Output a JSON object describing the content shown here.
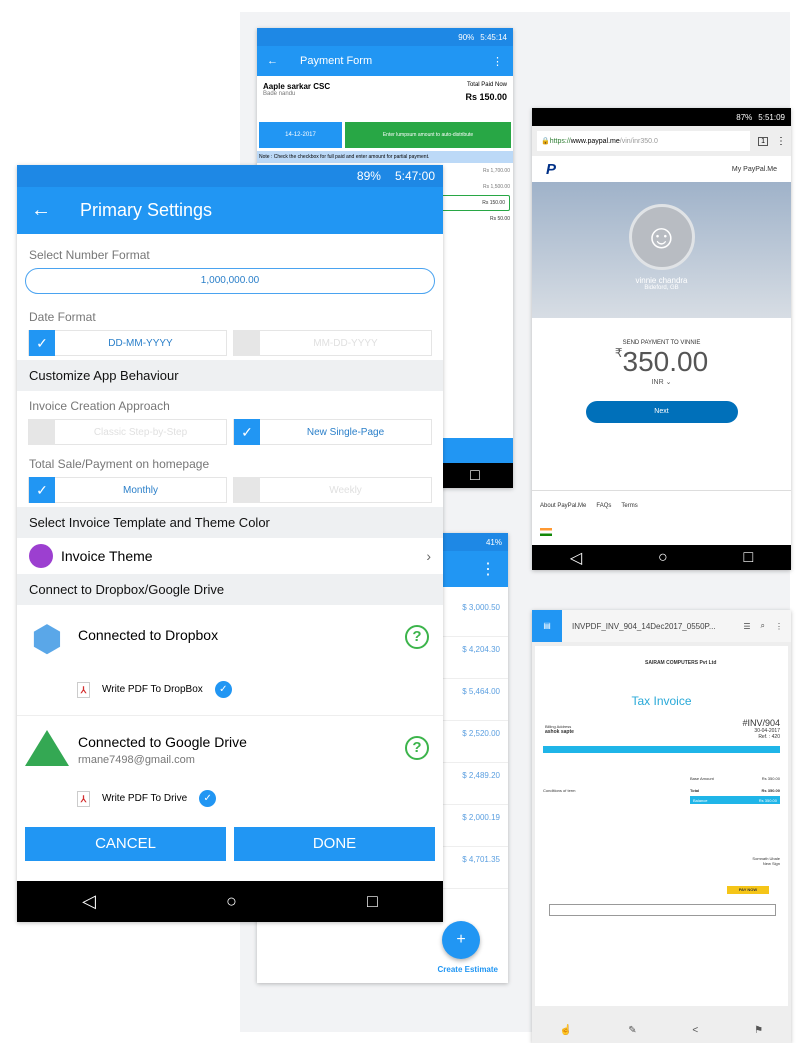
{
  "colors": {
    "primary": "#2196f3",
    "green": "#28a745",
    "paypal_blue": "#0070ba"
  },
  "payment_form": {
    "status": {
      "battery": "90%",
      "time": "5:45:14"
    },
    "title": "Payment Form",
    "party": "Aaple sarkar CSC",
    "sub": "Bade nandu",
    "total_label": "Total Paid Now",
    "total": "Rs 150.00",
    "date": "14-12-2017",
    "lumpsum": "Enter lumpsum amount to auto-distribute",
    "note": "Note : Check the checkbox for full paid and enter amount for partial payment.",
    "amounts": [
      "Rs 1,700.00",
      "Rs 1,500.00",
      "Rs 150.00",
      "Rs 50.00"
    ]
  },
  "paypal": {
    "status": {
      "battery": "87%",
      "time": "5:51:09"
    },
    "url_scheme": "https://",
    "url_host": "www.paypal.me",
    "url_path": "/vin/inr350.0",
    "tabs_count": "1",
    "my_link": "My PayPal.Me",
    "name": "vinnie chandra",
    "location": "Bideford, GB",
    "send_label": "SEND PAYMENT TO VINNIE",
    "currency_symbol": "₹",
    "amount": "350.00",
    "currency": "INR",
    "next": "Next",
    "footer": [
      "About PayPal.Me",
      "FAQs",
      "Terms"
    ]
  },
  "estimates": {
    "status": {
      "battery": "41%"
    },
    "amounts": [
      "$ 3,000.50",
      "$ 4,204.30",
      "$ 5,464.00",
      "$ 2,520.00",
      "$ 2,489.20",
      "$ 2,000.19",
      "$ 4,701.35"
    ],
    "fab": "+",
    "create": "Create Estimate"
  },
  "invoice": {
    "filename": "INVPDF_INV_904_14Dec2017_0550P...",
    "company": "SAIRAM COMPUTERS Pvt Ltd",
    "title": "Tax Invoice",
    "number": "#INV/904",
    "date": "30-04-2017",
    "ref": "Ref. : 420",
    "billing_label": "Billing Address",
    "customer": "ashok sapte",
    "base_label": "Base Amount",
    "base": "Rs 350.00",
    "total_label": "Total",
    "total": "Rs 350.00",
    "balance_label": "Balance",
    "balance": "Rs 350.00",
    "conditions": "Conditions of term",
    "signer": "Somnath Ubale",
    "sign": "New Sign",
    "pay_now": "PAY NOW"
  },
  "settings": {
    "status": {
      "battery": "89%",
      "time": "5:47:00"
    },
    "title": "Primary Settings",
    "number_format_label": "Select Number Format",
    "number_format": "1,000,000.00",
    "date_format_label": "Date Format",
    "date_options": [
      {
        "label": "DD-MM-YYYY",
        "checked": true
      },
      {
        "label": "MM-DD-YYYY",
        "checked": false
      }
    ],
    "customize_header": "Customize App Behaviour",
    "invoice_approach_label": "Invoice Creation Approach",
    "approach_options": [
      {
        "label": "Classic Step-by-Step",
        "checked": false
      },
      {
        "label": "New Single-Page",
        "checked": true
      }
    ],
    "homepage_label": "Total Sale/Payment on homepage",
    "homepage_options": [
      {
        "label": "Monthly",
        "checked": true
      },
      {
        "label": "Weekly",
        "checked": false
      }
    ],
    "template_header": "Select Invoice Template and Theme Color",
    "theme_label": "Invoice Theme",
    "theme_color": "#9c3fd0",
    "cloud_header": "Connect to Dropbox/Google Drive",
    "dropbox": {
      "title": "Connected to Dropbox",
      "write": "Write PDF To DropBox",
      "checked": true
    },
    "drive": {
      "title": "Connected to Google Drive",
      "email": "rmane7498@gmail.com",
      "write": "Write PDF To Drive",
      "checked": true
    },
    "cancel": "CANCEL",
    "done": "DONE"
  }
}
